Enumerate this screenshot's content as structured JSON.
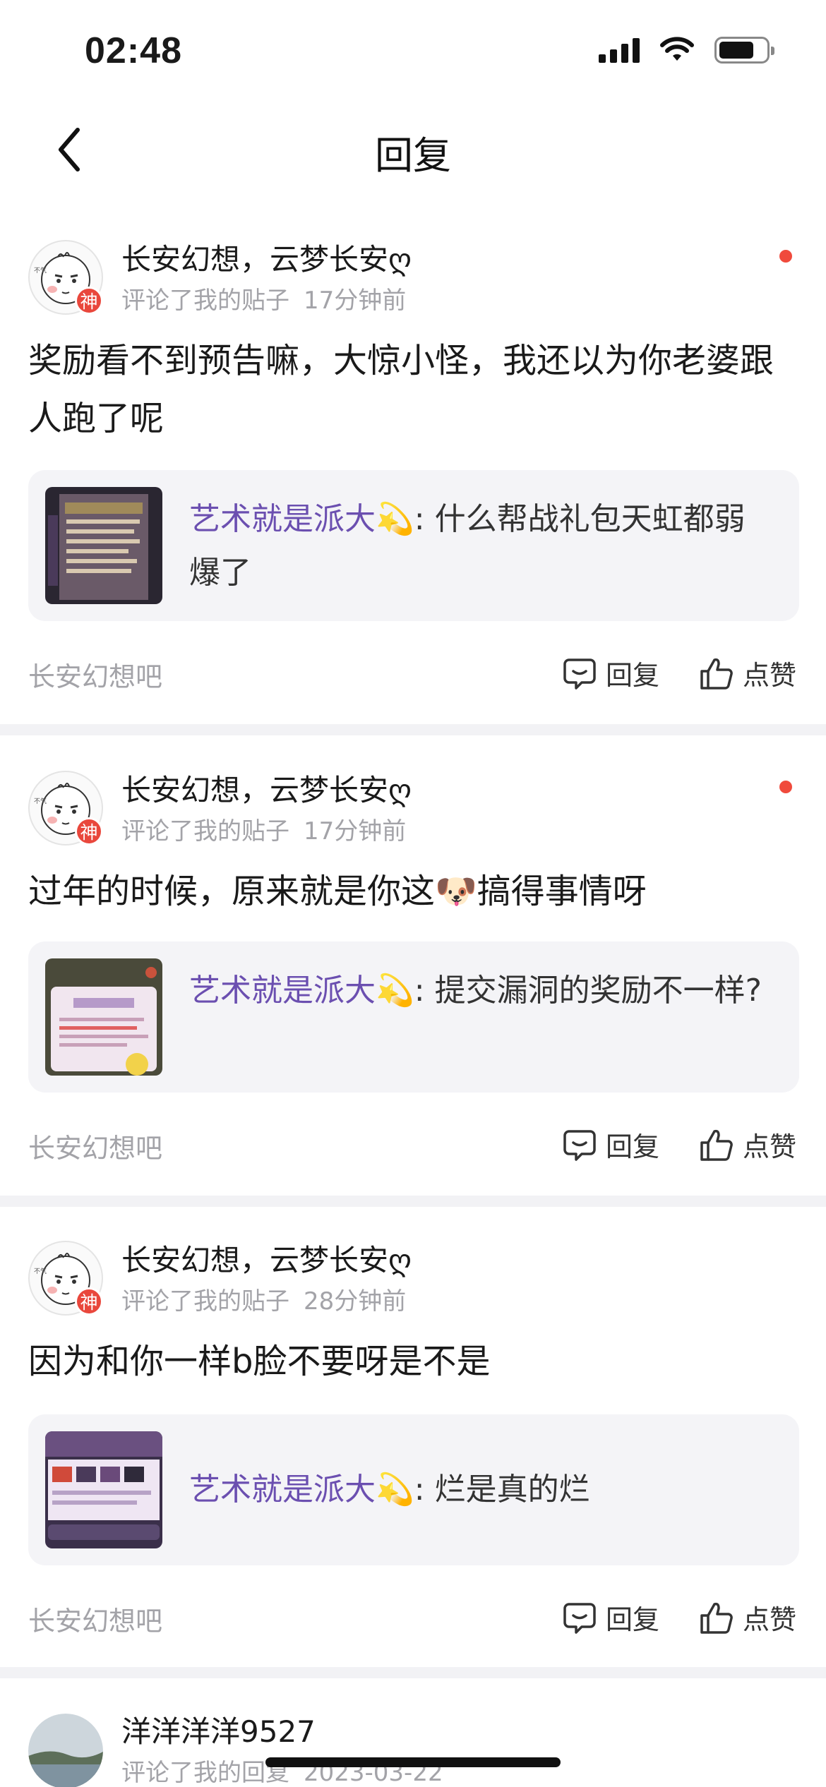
{
  "status_bar": {
    "time": "02:48"
  },
  "nav": {
    "title": "回复"
  },
  "notifications": [
    {
      "user": "长安幻想，云梦长安ღ",
      "badge": "神",
      "action_text": "评论了我的贴子",
      "time": "17分钟前",
      "unread": true,
      "comment": "奖励看不到预告嘛，大惊小怪，我还以为你老婆跟人跑了呢",
      "quote_author": "艺术就是派大💫",
      "quote_sep": ": ",
      "quote_text": "什么帮战礼包天虹都弱爆了",
      "forum": "长安幻想吧",
      "reply_label": "回复",
      "like_label": "点赞"
    },
    {
      "user": "长安幻想，云梦长安ღ",
      "badge": "神",
      "action_text": "评论了我的贴子",
      "time": "17分钟前",
      "unread": true,
      "comment": "过年的时候，原来就是你这🐶搞得事情呀",
      "quote_author": "艺术就是派大💫",
      "quote_sep": ": ",
      "quote_text": "提交漏洞的奖励不一样?",
      "forum": "长安幻想吧",
      "reply_label": "回复",
      "like_label": "点赞"
    },
    {
      "user": "长安幻想，云梦长安ღ",
      "badge": "神",
      "action_text": "评论了我的贴子",
      "time": "28分钟前",
      "unread": false,
      "comment": "因为和你一样b脸不要呀是不是",
      "quote_author": "艺术就是派大💫",
      "quote_sep": ": ",
      "quote_text": "烂是真的烂",
      "forum": "长安幻想吧",
      "reply_label": "回复",
      "like_label": "点赞"
    },
    {
      "user": "洋洋洋洋9527",
      "action_text": "评论了我的回复",
      "time": "2023-03-22"
    }
  ]
}
